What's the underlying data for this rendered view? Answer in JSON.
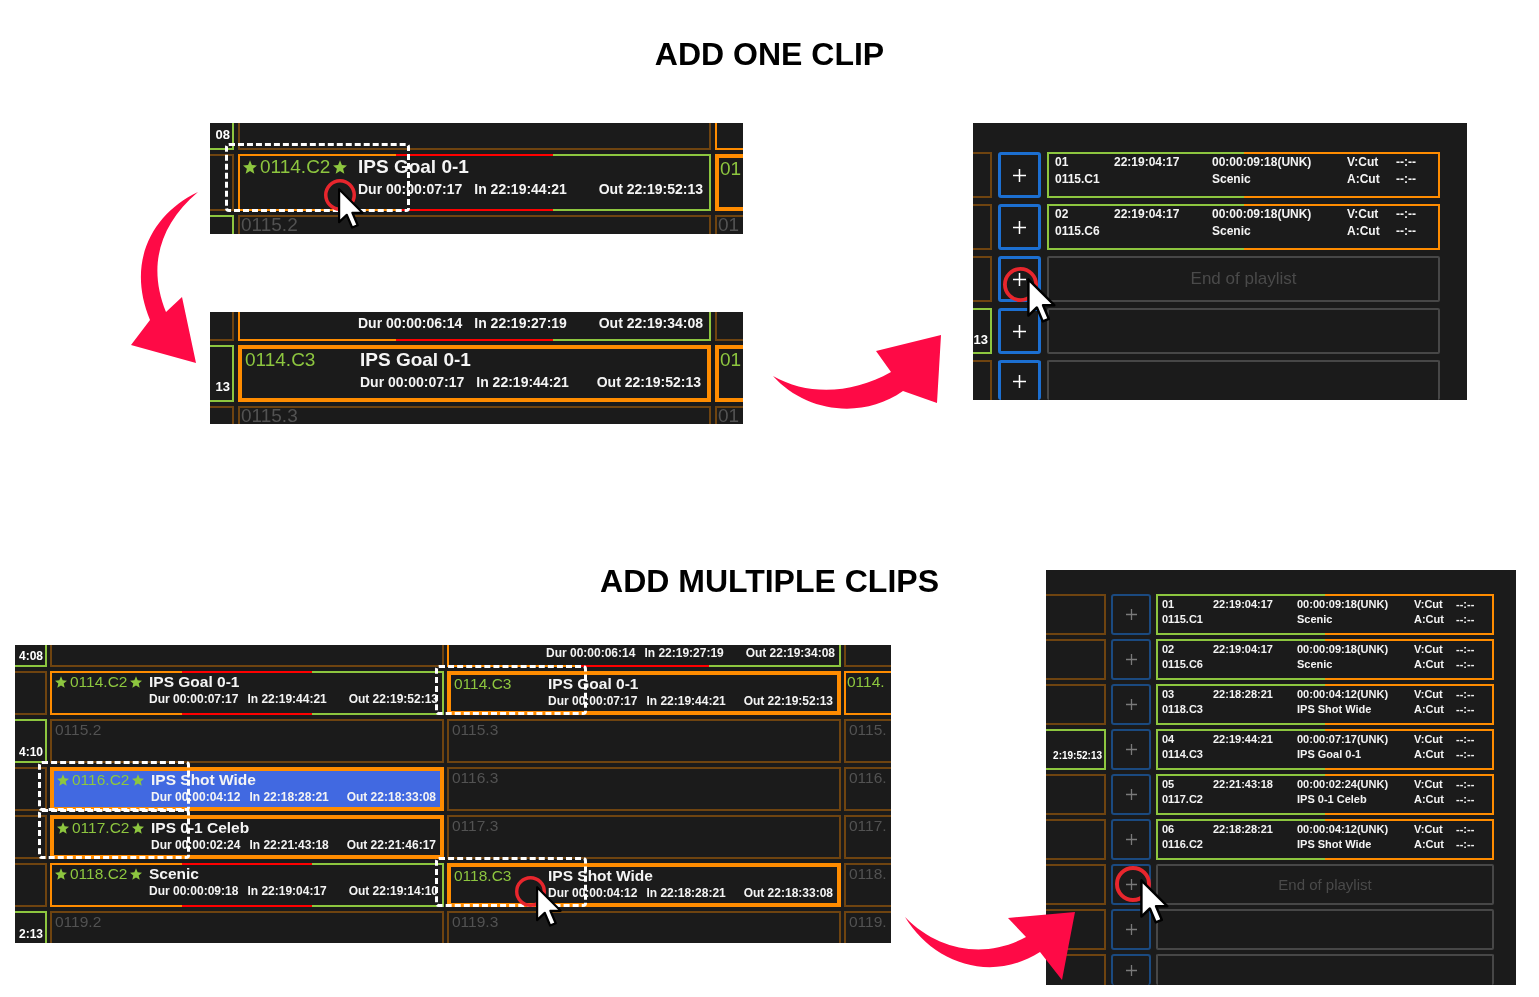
{
  "sections": [
    {
      "title": "ADD ONE CLIP",
      "panels": [
        {
          "kind": "grid",
          "rows": [
            {
              "cells": [
                {
                  "kind": "time",
                  "color": "#8dc63f",
                  "text": "08"
                },
                {
                  "kind": "empty",
                  "color": "#6f4410"
                },
                {
                  "kind": "empty",
                  "color": "#ff8c00"
                }
              ]
            },
            {
              "cells": [
                {
                  "kind": "empty",
                  "color": "#6f4410"
                },
                {
                  "kind": "clip",
                  "selected": false,
                  "id": "0114.C2",
                  "starred": true,
                  "title": "IPS Goal 0-1",
                  "dur": "Dur 00:00:07:17",
                  "in": "In 22:19:44:21",
                  "out": "Out 22:19:52:13",
                  "highlighted": false,
                  "outlined": true,
                  "clicked": true
                },
                {
                  "kind": "id",
                  "selected": true,
                  "text": "01"
                }
              ]
            },
            {
              "cells": [
                {
                  "kind": "empty",
                  "color": "#8dc63f"
                },
                {
                  "kind": "slot",
                  "color": "#6f4410",
                  "text": "0115.2"
                },
                {
                  "kind": "slot",
                  "color": "#6f4410",
                  "text": "01"
                }
              ]
            }
          ]
        },
        {
          "kind": "grid",
          "rows": [
            {
              "cells": [
                {
                  "kind": "empty",
                  "color": "#6f4410"
                },
                {
                  "kind": "times",
                  "dur": "Dur 00:00:06:14",
                  "in": "In 22:19:27:19",
                  "out": "Out 22:19:34:08"
                },
                {
                  "kind": "empty",
                  "color": "#6f4410"
                }
              ]
            },
            {
              "cells": [
                {
                  "kind": "time",
                  "color": "#8dc63f",
                  "text": "13"
                },
                {
                  "kind": "clip",
                  "selected": true,
                  "id": "0114.C3",
                  "starred": false,
                  "title": "IPS Goal 0-1",
                  "dur": "Dur 00:00:07:17",
                  "in": "In 22:19:44:21",
                  "out": "Out 22:19:52:13",
                  "highlighted": false,
                  "outlined": false,
                  "clicked": false
                },
                {
                  "kind": "id",
                  "selected": true,
                  "text": "01"
                }
              ]
            },
            {
              "cells": [
                {
                  "kind": "empty",
                  "color": "#6f4410"
                },
                {
                  "kind": "slot",
                  "color": "#6f4410",
                  "text": "0115.3"
                },
                {
                  "kind": "slot",
                  "color": "#6f4410",
                  "text": "01"
                }
              ]
            }
          ]
        },
        {
          "kind": "playlist",
          "dimmed": false,
          "rows": [
            {
              "side": {
                "kind": "empty",
                "color": "#6f4410"
              },
              "add": {
                "clicked": false
              },
              "entry": {
                "kind": "clip",
                "number": "01",
                "start": "22:19:04:17",
                "duration": "00:00:09:18(UNK)",
                "video": "V:Cut",
                "video_time": "--:--",
                "clip": "0115.C1",
                "title": "Scenic",
                "audio": "A:Cut",
                "audio_time": "--:--"
              }
            },
            {
              "side": {
                "kind": "empty",
                "color": "#6f4410"
              },
              "add": {
                "clicked": false
              },
              "entry": {
                "kind": "clip",
                "number": "02",
                "start": "22:19:04:17",
                "duration": "00:00:09:18(UNK)",
                "video": "V:Cut",
                "video_time": "--:--",
                "clip": "0115.C6",
                "title": "Scenic",
                "audio": "A:Cut",
                "audio_time": "--:--"
              }
            },
            {
              "side": {
                "kind": "empty",
                "color": "#6f4410"
              },
              "add": {
                "clicked": true
              },
              "entry": {
                "kind": "end",
                "text": "End of playlist"
              }
            },
            {
              "side": {
                "kind": "time",
                "color": "#8dc63f",
                "text": "13"
              },
              "add": {
                "clicked": false
              },
              "entry": {
                "kind": "empty"
              }
            },
            {
              "side": {
                "kind": "empty",
                "color": "#6f4410"
              },
              "add": {
                "clicked": false
              },
              "entry": {
                "kind": "empty"
              }
            }
          ]
        }
      ]
    },
    {
      "title": "ADD MULTIPLE CLIPS",
      "panels": [
        {
          "kind": "grid",
          "rows": [
            {
              "cells": [
                {
                  "kind": "time",
                  "color": "#8dc63f",
                  "text": "4:08"
                },
                {
                  "kind": "empty",
                  "color": "#6f4410"
                },
                {
                  "kind": "times",
                  "dur": "Dur 00:00:06:14",
                  "in": "In 22:19:27:19",
                  "out": "Out 22:19:34:08"
                },
                {
                  "kind": "empty",
                  "color": "#6f4410"
                }
              ]
            },
            {
              "cells": [
                {
                  "kind": "empty",
                  "color": "#6f4410"
                },
                {
                  "kind": "clip",
                  "selected": false,
                  "id": "0114.C2",
                  "starred": true,
                  "title": "IPS Goal 0-1",
                  "dur": "Dur 00:00:07:17",
                  "in": "In 22:19:44:21",
                  "out": "Out 22:19:52:13",
                  "highlighted": false,
                  "outlined": false,
                  "clicked": false
                },
                {
                  "kind": "clip",
                  "selected": true,
                  "id": "0114.C3",
                  "starred": false,
                  "title": "IPS Goal 0-1",
                  "dur": "Dur 00:00:07:17",
                  "in": "In 22:19:44:21",
                  "out": "Out 22:19:52:13",
                  "highlighted": false,
                  "outlined": true,
                  "clicked": false
                },
                {
                  "kind": "id",
                  "selected": false,
                  "text": "0114."
                }
              ]
            },
            {
              "cells": [
                {
                  "kind": "time",
                  "color": "#8dc63f",
                  "text": "4:10"
                },
                {
                  "kind": "slot",
                  "color": "#6f4410",
                  "text": "0115.2"
                },
                {
                  "kind": "slot",
                  "color": "#6f4410",
                  "text": "0115.3"
                },
                {
                  "kind": "slot",
                  "color": "#6f4410",
                  "text": "0115."
                }
              ]
            },
            {
              "cells": [
                {
                  "kind": "empty",
                  "color": "#6f4410"
                },
                {
                  "kind": "clip",
                  "selected": true,
                  "id": "0116.C2",
                  "starred": true,
                  "title": "IPS Shot Wide",
                  "dur": "Dur 00:00:04:12",
                  "in": "In 22:18:28:21",
                  "out": "Out 22:18:33:08",
                  "highlighted": true,
                  "outlined": true,
                  "clicked": false
                },
                {
                  "kind": "slot",
                  "color": "#6f4410",
                  "text": "0116.3"
                },
                {
                  "kind": "slot",
                  "color": "#6f4410",
                  "text": "0116."
                }
              ]
            },
            {
              "cells": [
                {
                  "kind": "empty",
                  "color": "#6f4410"
                },
                {
                  "kind": "clip",
                  "selected": true,
                  "id": "0117.C2",
                  "starred": true,
                  "title": "IPS 0-1 Celeb",
                  "dur": "Dur 00:00:02:24",
                  "in": "In 22:21:43:18",
                  "out": "Out 22:21:46:17",
                  "highlighted": false,
                  "outlined": true,
                  "clicked": false
                },
                {
                  "kind": "slot",
                  "color": "#6f4410",
                  "text": "0117.3"
                },
                {
                  "kind": "slot",
                  "color": "#6f4410",
                  "text": "0117."
                }
              ]
            },
            {
              "cells": [
                {
                  "kind": "empty",
                  "color": "#6f4410"
                },
                {
                  "kind": "clip",
                  "selected": false,
                  "id": "0118.C2",
                  "starred": true,
                  "title": "Scenic",
                  "dur": "Dur 00:00:09:18",
                  "in": "In 22:19:04:17",
                  "out": "Out 22:19:14:10",
                  "highlighted": false,
                  "outlined": false,
                  "clicked": false
                },
                {
                  "kind": "clip",
                  "selected": true,
                  "id": "0118.C3",
                  "starred": false,
                  "title": "IPS Shot Wide",
                  "dur": "Dur 00:00:04:12",
                  "in": "In 22:18:28:21",
                  "out": "Out 22:18:33:08",
                  "highlighted": false,
                  "outlined": true,
                  "clicked": true
                },
                {
                  "kind": "slot",
                  "color": "#6f4410",
                  "text": "0118."
                }
              ]
            },
            {
              "cells": [
                {
                  "kind": "time",
                  "color": "#8dc63f",
                  "text": "2:13"
                },
                {
                  "kind": "slot",
                  "color": "#6f4410",
                  "text": "0119.2"
                },
                {
                  "kind": "slot",
                  "color": "#6f4410",
                  "text": "0119.3"
                },
                {
                  "kind": "slot",
                  "color": "#6f4410",
                  "text": "0119."
                }
              ]
            }
          ]
        },
        {
          "kind": "playlist",
          "dimmed": true,
          "rows": [
            {
              "side": {
                "kind": "empty",
                "color": "#6f4410"
              },
              "add": {
                "clicked": false
              },
              "entry": {
                "kind": "clip",
                "number": "01",
                "start": "22:19:04:17",
                "duration": "00:00:09:18(UNK)",
                "video": "V:Cut",
                "video_time": "--:--",
                "clip": "0115.C1",
                "title": "Scenic",
                "audio": "A:Cut",
                "audio_time": "--:--"
              }
            },
            {
              "side": {
                "kind": "empty",
                "color": "#6f4410"
              },
              "add": {
                "clicked": false
              },
              "entry": {
                "kind": "clip",
                "number": "02",
                "start": "22:19:04:17",
                "duration": "00:00:09:18(UNK)",
                "video": "V:Cut",
                "video_time": "--:--",
                "clip": "0115.C6",
                "title": "Scenic",
                "audio": "A:Cut",
                "audio_time": "--:--"
              }
            },
            {
              "side": {
                "kind": "empty",
                "color": "#6f4410"
              },
              "add": {
                "clicked": false
              },
              "entry": {
                "kind": "clip",
                "number": "03",
                "start": "22:18:28:21",
                "duration": "00:00:04:12(UNK)",
                "video": "V:Cut",
                "video_time": "--:--",
                "clip": "0118.C3",
                "title": "IPS Shot Wide",
                "audio": "A:Cut",
                "audio_time": "--:--"
              }
            },
            {
              "side": {
                "kind": "time",
                "color": "#8dc63f",
                "text": "2:19:52:13"
              },
              "add": {
                "clicked": false
              },
              "entry": {
                "kind": "clip",
                "number": "04",
                "start": "22:19:44:21",
                "duration": "00:00:07:17(UNK)",
                "video": "V:Cut",
                "video_time": "--:--",
                "clip": "0114.C3",
                "title": "IPS Goal 0-1",
                "audio": "A:Cut",
                "audio_time": "--:--"
              }
            },
            {
              "side": {
                "kind": "empty",
                "color": "#6f4410"
              },
              "add": {
                "clicked": false
              },
              "entry": {
                "kind": "clip",
                "number": "05",
                "start": "22:21:43:18",
                "duration": "00:00:02:24(UNK)",
                "video": "V:Cut",
                "video_time": "--:--",
                "clip": "0117.C2",
                "title": "IPS 0-1 Celeb",
                "audio": "A:Cut",
                "audio_time": "--:--"
              }
            },
            {
              "side": {
                "kind": "empty",
                "color": "#6f4410"
              },
              "add": {
                "clicked": false
              },
              "entry": {
                "kind": "clip",
                "number": "06",
                "start": "22:18:28:21",
                "duration": "00:00:04:12(UNK)",
                "video": "V:Cut",
                "video_time": "--:--",
                "clip": "0116.C2",
                "title": "IPS Shot Wide",
                "audio": "A:Cut",
                "audio_time": "--:--"
              }
            },
            {
              "side": {
                "kind": "empty",
                "color": "#6f4410"
              },
              "add": {
                "clicked": true
              },
              "entry": {
                "kind": "end",
                "text": "End of playlist"
              }
            },
            {
              "side": {
                "kind": "empty",
                "color": "#6f4410"
              },
              "add": {
                "clicked": false
              },
              "entry": {
                "kind": "empty"
              }
            },
            {
              "side": {
                "kind": "empty",
                "color": "#6f4410"
              },
              "add": {
                "clicked": false
              },
              "entry": {
                "kind": "empty"
              }
            }
          ]
        }
      ]
    }
  ]
}
